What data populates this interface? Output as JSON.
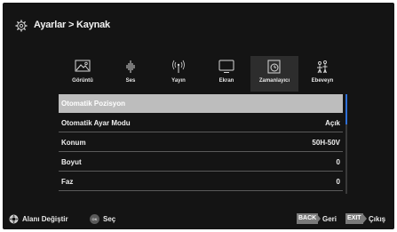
{
  "header": {
    "breadcrumb": "Ayarlar > Kaynak",
    "icon": "gear-icon"
  },
  "tabs": [
    {
      "label": "Görüntü",
      "icon": "picture-icon"
    },
    {
      "label": "Ses",
      "icon": "sound-icon"
    },
    {
      "label": "Yayın",
      "icon": "antenna-icon"
    },
    {
      "label": "Ekran",
      "icon": "monitor-icon"
    },
    {
      "label": "Zamanlayıcı",
      "icon": "timer-icon"
    },
    {
      "label": "Ebeveyn",
      "icon": "parental-icon"
    }
  ],
  "menu": {
    "items": [
      {
        "label": "Otomatik Pozisyon",
        "value": ""
      },
      {
        "label": "Otomatik Ayar Modu",
        "value": "Açık"
      },
      {
        "label": "Konum",
        "value": "50H-50V"
      },
      {
        "label": "Boyut",
        "value": "0"
      },
      {
        "label": "Faz",
        "value": "0"
      }
    ]
  },
  "footer": {
    "navigate_label": "Alanı Değiştir",
    "ok_key": "OK",
    "select_label": "Seç",
    "back_key": "BACK",
    "back_label": "Geri",
    "exit_key": "EXIT",
    "exit_label": "Çıkış"
  },
  "colors": {
    "background": "#141414",
    "selected_row": "#bdbdbd",
    "scroll_thumb": "#2f6fd6",
    "key_badge": "#7a7a7a"
  }
}
